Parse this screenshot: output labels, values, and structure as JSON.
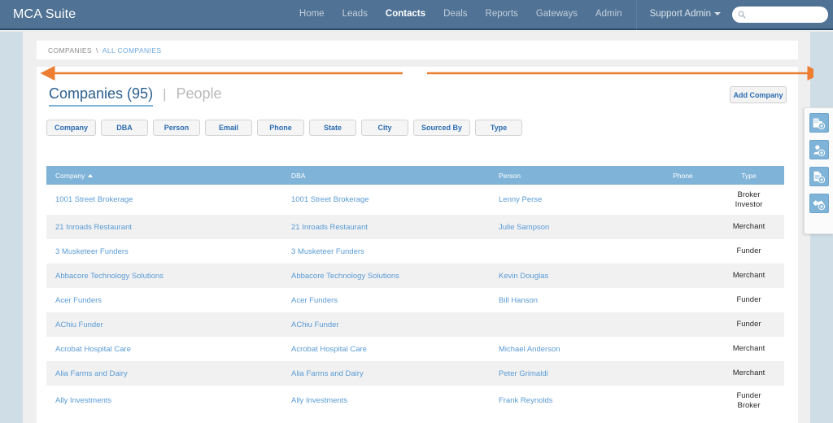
{
  "app": {
    "brand": "MCA Suite"
  },
  "topnav": {
    "links": [
      {
        "label": "Home",
        "active": false
      },
      {
        "label": "Leads",
        "active": false
      },
      {
        "label": "Contacts",
        "active": true
      },
      {
        "label": "Deals",
        "active": false
      },
      {
        "label": "Reports",
        "active": false
      },
      {
        "label": "Gateways",
        "active": false
      },
      {
        "label": "Admin",
        "active": false
      }
    ],
    "user": "Support Admin",
    "search": {
      "value": "",
      "placeholder": ""
    }
  },
  "breadcrumb": {
    "root": "COMPANIES",
    "separator": "\\",
    "current": "ALL COMPANIES"
  },
  "tabs": {
    "active": "Companies (95)",
    "divider": "|",
    "inactive": "People"
  },
  "actions": {
    "add_company": "Add Company"
  },
  "filters": [
    "Company",
    "DBA",
    "Person",
    "Email",
    "Phone",
    "State",
    "City",
    "Sourced By",
    "Type"
  ],
  "table": {
    "columns": [
      {
        "label": "Company",
        "sorted": "asc"
      },
      {
        "label": "DBA",
        "sorted": ""
      },
      {
        "label": "Person",
        "sorted": ""
      },
      {
        "label": "Phone",
        "sorted": ""
      },
      {
        "label": "Type",
        "sorted": ""
      }
    ],
    "rows": [
      {
        "company": "1001 Street Brokerage",
        "dba": "1001 Street Brokerage",
        "person": "Lenny Perse",
        "phone": "",
        "type": "Broker\nInvestor",
        "tall": true
      },
      {
        "company": "21 Inroads Restaurant",
        "dba": "21 Inroads Restaurant",
        "person": "Julie Sampson",
        "phone": "",
        "type": "Merchant",
        "tall": false
      },
      {
        "company": "3 Musketeer Funders",
        "dba": "3 Musketeer Funders",
        "person": "",
        "phone": "",
        "type": "Funder",
        "tall": false
      },
      {
        "company": "Abbacore Technology Solutions",
        "dba": "Abbacore Technology Solutions",
        "person": "Kevin Douglas",
        "phone": "",
        "type": "Merchant",
        "tall": false
      },
      {
        "company": "Acer Funders",
        "dba": "Acer Funders",
        "person": "Bill Hanson",
        "phone": "",
        "type": "Funder",
        "tall": false
      },
      {
        "company": "AChiu Funder",
        "dba": "AChiu Funder",
        "person": "",
        "phone": "",
        "type": "Funder",
        "tall": false
      },
      {
        "company": "Acrobat Hospital Care",
        "dba": "Acrobat Hospital Care",
        "person": "Michael Anderson",
        "phone": "",
        "type": "Merchant",
        "tall": false
      },
      {
        "company": "Alia Farms and Dairy",
        "dba": "Alia Farms and Dairy",
        "person": "Peter Grimaldi",
        "phone": "",
        "type": "Merchant",
        "tall": false
      },
      {
        "company": "Ally Investments",
        "dba": "Ally Investments",
        "person": "Frank Reynolds",
        "phone": "",
        "type": "Funder\nBroker",
        "tall": true
      }
    ]
  },
  "fab_panel": {
    "items": [
      {
        "icon": "add-company-icon"
      },
      {
        "icon": "add-person-icon"
      },
      {
        "icon": "add-document-icon"
      },
      {
        "icon": "add-deal-icon"
      }
    ]
  },
  "annotations": {
    "arrow_left": "left-arrow-annotation",
    "arrow_right": "right-arrow-annotation"
  },
  "colors": {
    "nav_blue": "#4f7295",
    "table_header_blue": "#7fb3d8",
    "link_blue": "#5a9bd5",
    "annotation_orange": "#ed7d31",
    "rail_blue": "#cfdde7"
  }
}
